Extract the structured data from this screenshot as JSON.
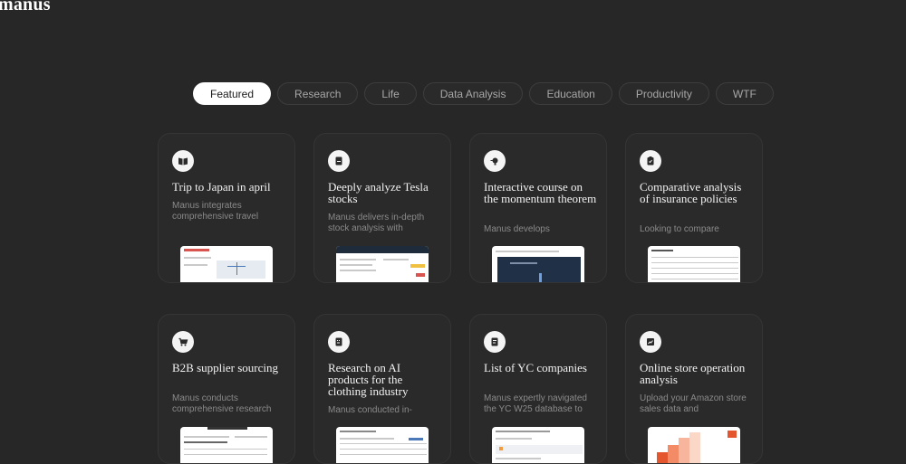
{
  "app": {
    "logo": "manus"
  },
  "tabs": [
    {
      "label": "Featured",
      "active": true
    },
    {
      "label": "Research",
      "active": false
    },
    {
      "label": "Life",
      "active": false
    },
    {
      "label": "Data Analysis",
      "active": false
    },
    {
      "label": "Education",
      "active": false
    },
    {
      "label": "Productivity",
      "active": false
    },
    {
      "label": "WTF",
      "active": false
    }
  ],
  "cards": [
    {
      "icon": "book-open-icon",
      "title": "Trip to Japan in april",
      "desc": "Manus integrates comprehensive travel information to create"
    },
    {
      "icon": "document-icon",
      "title": "Deeply analyze Tesla stocks",
      "desc": "Manus delivers in-depth stock analysis with"
    },
    {
      "icon": "lightbulb-icon",
      "title": "Interactive course on the momentum theorem",
      "desc": "Manus develops"
    },
    {
      "icon": "clipboard-icon",
      "title": "Comparative analysis of insurance policies",
      "desc": "Looking to compare"
    },
    {
      "icon": "cart-icon",
      "title": "B2B supplier sourcing",
      "desc": "Manus conducts comprehensive research"
    },
    {
      "icon": "calculator-icon",
      "title": "Research on AI products for the clothing industry",
      "desc": "Manus conducted in-"
    },
    {
      "icon": "list-document-icon",
      "title": "List of YC companies",
      "desc": "Manus expertly navigated the YC W25 database to"
    },
    {
      "icon": "chart-icon",
      "title": "Online store operation analysis",
      "desc": "Upload your Amazon store sales data and"
    }
  ],
  "colors": {
    "background": "#272727",
    "card": "#2a2a2a",
    "active_tab": "#ffffff"
  }
}
